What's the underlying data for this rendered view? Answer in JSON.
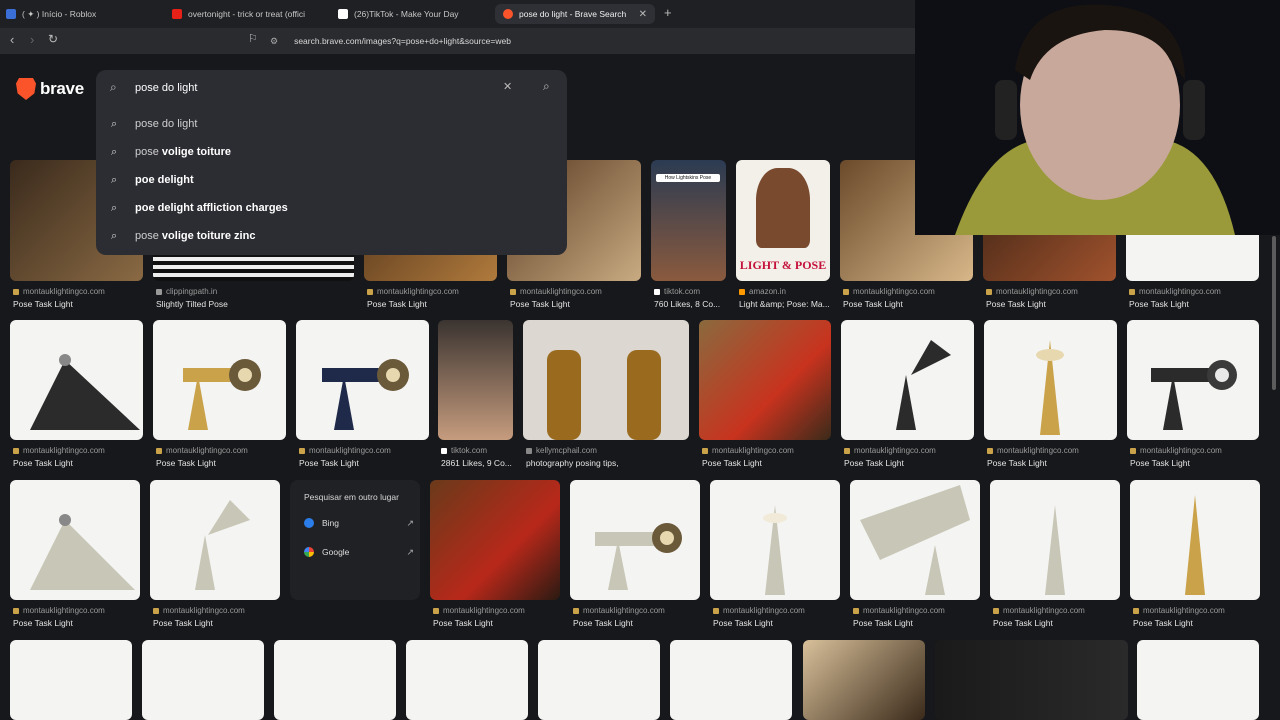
{
  "tabs": [
    {
      "title": "( ✦ ) Início - Roblox",
      "favicon_color": "#3b6fd8"
    },
    {
      "title": "overtonight - trick or treat (offici",
      "favicon_color": "#e62117"
    },
    {
      "title": "(26)TikTok - Make Your Day",
      "favicon_color": "#ffffff"
    },
    {
      "title": "pose do light - Brave Search",
      "favicon_color": "#fb542b"
    }
  ],
  "new_tab_icon": "plus-icon",
  "address": {
    "url": "search.brave.com/images?q=pose+do+light&source=web"
  },
  "brand": {
    "name": "brave",
    "accent": "#fb542b"
  },
  "search": {
    "query": "pose do light",
    "suggestions": [
      {
        "plain": "pose do light",
        "bold": ""
      },
      {
        "plain": "pose ",
        "bold": "volige toiture"
      },
      {
        "plain": "",
        "bold": "poe delight"
      },
      {
        "plain": "",
        "bold": "poe delight affliction charges"
      },
      {
        "plain": "pose ",
        "bold": "volige toiture zinc"
      }
    ]
  },
  "results": {
    "row1": [
      {
        "source": "montauklightingco.com",
        "title": "Pose Task Light"
      },
      {
        "source": "clippingpath.in",
        "title": "Slightly Tilted Pose"
      },
      {
        "source": "montauklightingco.com",
        "title": "Pose Task Light"
      },
      {
        "source": "montauklightingco.com",
        "title": "Pose Task Light"
      },
      {
        "source": "tiktok.com",
        "title": "760 Likes, 8 Co..."
      },
      {
        "source": "amazon.in",
        "title": "Light &amp; Pose: Ma..."
      },
      {
        "source": "montauklightingco.com",
        "title": "Pose Task Light"
      },
      {
        "source": "montauklightingco.com",
        "title": "Pose Task Light"
      },
      {
        "source": "montauklightingco.com",
        "title": "Pose Task Light"
      }
    ],
    "row1_thumb_text": {
      "tiktok": "How Lightskins Pose",
      "amazon": "LIGHT & POSE"
    },
    "row2": [
      {
        "source": "montauklightingco.com",
        "title": "Pose Task Light"
      },
      {
        "source": "montauklightingco.com",
        "title": "Pose Task Light"
      },
      {
        "source": "montauklightingco.com",
        "title": "Pose Task Light"
      },
      {
        "source": "tiktok.com",
        "title": "2861 Likes, 9 Co..."
      },
      {
        "source": "kellymcphail.com",
        "title": "photography posing tips,"
      },
      {
        "source": "montauklightingco.com",
        "title": "Pose Task Light"
      },
      {
        "source": "montauklightingco.com",
        "title": "Pose Task Light"
      },
      {
        "source": "montauklightingco.com",
        "title": "Pose Task Light"
      },
      {
        "source": "montauklightingco.com",
        "title": "Pose Task Light"
      }
    ],
    "row3": [
      {
        "source": "montauklightingco.com",
        "title": "Pose Task Light"
      },
      {
        "source": "montauklightingco.com",
        "title": "Pose Task Light"
      },
      {
        "source": "montauklightingco.com",
        "title": "Pose Task Light"
      },
      {
        "source": "montauklightingco.com",
        "title": "Pose Task Light"
      },
      {
        "source": "montauklightingco.com",
        "title": "Pose Task Light"
      },
      {
        "source": "montauklightingco.com",
        "title": "Pose Task Light"
      },
      {
        "source": "montauklightingco.com",
        "title": "Pose Task Light"
      },
      {
        "source": "montauklightingco.com",
        "title": "Pose Task Light"
      }
    ]
  },
  "elsewhere": {
    "heading": "Pesquisar em outro lugar",
    "engines": [
      {
        "name": "Bing",
        "color": "#2b7de9"
      },
      {
        "name": "Google",
        "color": "#ea4335"
      }
    ]
  }
}
